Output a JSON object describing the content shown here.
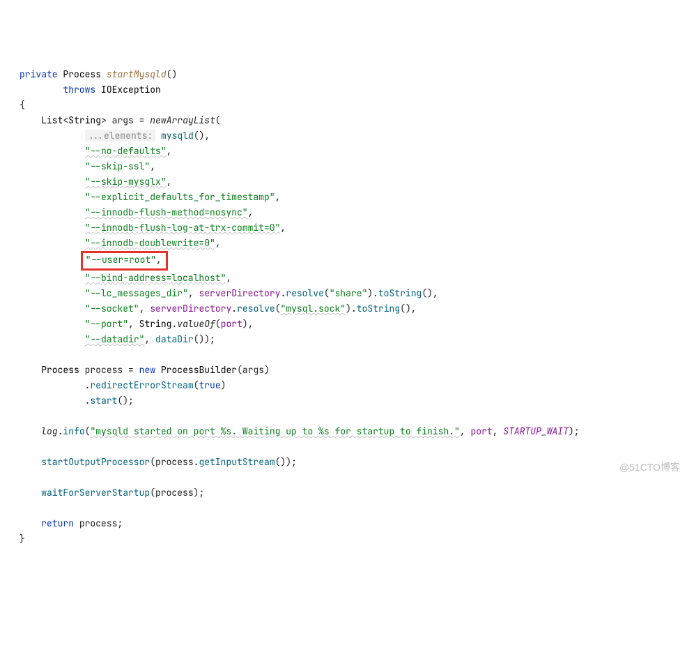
{
  "kw_private": "private",
  "type_Process": "Process",
  "decl_startMysqld": "startMysqld",
  "kw_throws": "throws",
  "type_IOException": "IOException",
  "lbrace": "{",
  "rbrace": "}",
  "type_List": "List",
  "type_String": "String",
  "var_args": "args",
  "eq": "=",
  "fn_newArrayList": "newArrayList",
  "hint_elements": "...elements:",
  "fn_mysqld": "mysqld",
  "s_nodefaults": "\"--no-defaults\"",
  "s_skipssl": "\"--skip-ssl\"",
  "s_skipmysqlx": "\"--skip-mysqlx\"",
  "s_explicitts": "\"--explicit_defaults_for_timestamp\"",
  "s_flushmethod": "\"--innodb-flush-method=nosync\"",
  "s_flushlog": "\"--innodb-flush-log-at-trx-commit=0\"",
  "s_doublewrite": "\"--innodb-doublewrite=0\"",
  "s_userroot": "\"--user=root\"",
  "s_bindaddr": "\"--bind-address=localhost\"",
  "s_lcmsg": "\"--lc_messages_dir\"",
  "s_share": "\"share\"",
  "s_socket": "\"--socket\"",
  "s_mysqlsock": "\"mysql.sock\"",
  "s_port": "\"--port\"",
  "s_datadir": "\"--datadir\"",
  "field_serverDirectory": "serverDirectory",
  "m_resolve": "resolve",
  "m_toString": "toString",
  "m_valueOf": "valueOf",
  "field_port": "port",
  "fn_dataDir": "dataDir",
  "var_process": "process",
  "kw_new": "new",
  "type_ProcessBuilder": "ProcessBuilder",
  "m_redirectErrorStream": "redirectErrorStream",
  "kw_true": "true",
  "m_start": "start",
  "field_log": "log",
  "m_info": "info",
  "s_logmsg": "\"mysqld started on port %s. Waiting up to %s for startup to finish.\"",
  "const_STARTUP_WAIT": "STARTUP_WAIT",
  "fn_startOutputProcessor": "startOutputProcessor",
  "m_getInputStream": "getInputStream",
  "fn_waitForServerStartup": "waitForServerStartup",
  "kw_return": "return",
  "comma": ",",
  "semi": ";",
  "lt": "<",
  "gt": ">",
  "dot": ".",
  "lp": "(",
  "rp": ")",
  "paren_close_semi": ");",
  "paren_close_comma": "(),",
  "empty_args": "()",
  "watermark": "@51CTO博客"
}
